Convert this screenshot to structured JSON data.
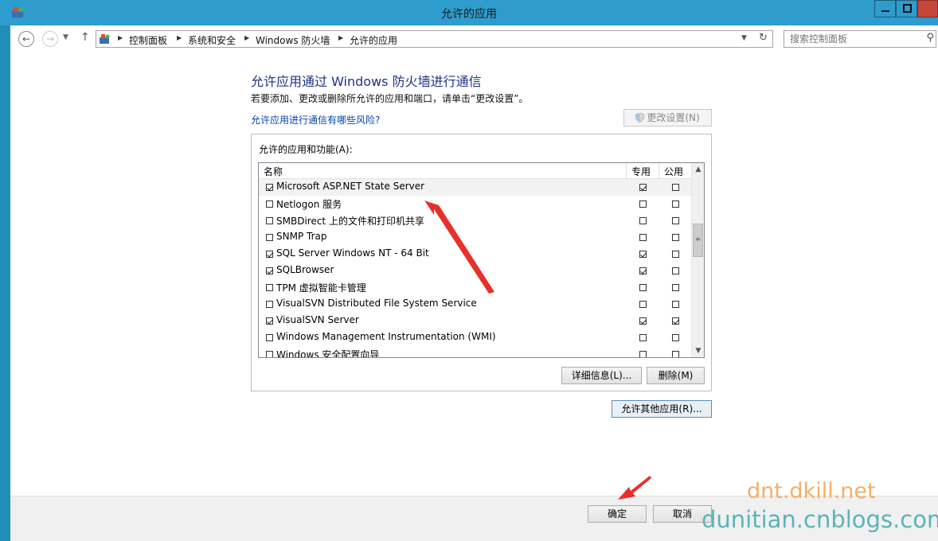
{
  "window": {
    "title": "允许的应用"
  },
  "nav": {
    "breadcrumbs": [
      "控制面板",
      "系统和安全",
      "Windows 防火墙",
      "允许的应用"
    ],
    "search_placeholder": "搜索控制面板"
  },
  "page": {
    "heading": "允许应用通过 Windows 防火墙进行通信",
    "description": "若要添加、更改或删除所允许的应用和端口，请单击“更改设置”。",
    "risk_link": "允许应用进行通信有哪些风险?",
    "change_settings_label": "更改设置(N)",
    "group_label": "允许的应用和功能(A):"
  },
  "list": {
    "columns": [
      "名称",
      "专用",
      "公用"
    ],
    "rows": [
      {
        "name": "Microsoft ASP.NET State Server",
        "enabled": true,
        "private": true,
        "public": false
      },
      {
        "name": "Netlogon 服务",
        "enabled": false,
        "private": false,
        "public": false
      },
      {
        "name": "SMBDirect 上的文件和打印机共享",
        "enabled": false,
        "private": false,
        "public": false
      },
      {
        "name": "SNMP Trap",
        "enabled": false,
        "private": false,
        "public": false
      },
      {
        "name": "SQL Server Windows NT - 64 Bit",
        "enabled": true,
        "private": true,
        "public": false
      },
      {
        "name": "SQLBrowser",
        "enabled": true,
        "private": true,
        "public": false
      },
      {
        "name": "TPM 虚拟智能卡管理",
        "enabled": false,
        "private": false,
        "public": false
      },
      {
        "name": "VisualSVN Distributed File System Service",
        "enabled": false,
        "private": false,
        "public": false
      },
      {
        "name": "VisualSVN Server",
        "enabled": true,
        "private": true,
        "public": true
      },
      {
        "name": "Windows Management Instrumentation (WMI)",
        "enabled": false,
        "private": false,
        "public": false
      },
      {
        "name": "Windows 安全配置向导",
        "enabled": false,
        "private": false,
        "public": false
      }
    ]
  },
  "buttons": {
    "details": "详细信息(L)...",
    "remove": "删除(M)",
    "allow_other": "允许其他应用(R)...",
    "ok": "确定",
    "cancel": "取消"
  },
  "watermarks": {
    "line1": "dnt.dkill.net",
    "line2": "dunitian.cnblogs.com"
  },
  "colors": {
    "titlebar": "#2e9ccc",
    "heading": "#1e3287",
    "link": "#0645ad",
    "annotation_arrow": "#e8302a"
  }
}
